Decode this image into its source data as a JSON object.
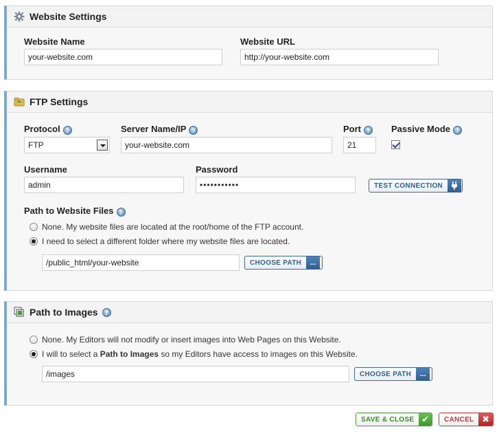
{
  "website_settings": {
    "title": "Website Settings",
    "icon": "gear-icon",
    "name_label": "Website Name",
    "name_value": "your-website.com",
    "url_label": "Website URL",
    "url_value": "http://your-website.com"
  },
  "ftp_settings": {
    "title": "FTP Settings",
    "icon": "ftp-folder-icon",
    "protocol_label": "Protocol",
    "protocol_value": "FTP",
    "server_label": "Server Name/IP",
    "server_value": "your-website.com",
    "port_label": "Port",
    "port_value": "21",
    "passive_label": "Passive Mode",
    "passive_checked": true,
    "username_label": "Username",
    "username_value": "admin",
    "password_label": "Password",
    "password_value": "•••••••••••",
    "test_button": "TEST CONNECTION",
    "path_label": "Path to Website Files",
    "radio_root": "None. My website files are located at the root/home of the FTP account.",
    "radio_folder": "I need to select a different folder where my website files are located.",
    "path_value": "/public_html/your-website",
    "choose_path": "CHOOSE PATH",
    "choose_tail": "..."
  },
  "images": {
    "title": "Path to Images",
    "icon": "images-icon",
    "radio_none": "None. My Editors will not modify or insert images into Web Pages on this Website.",
    "radio_select_prefix": "I will to select a ",
    "radio_select_bold": "Path to Images",
    "radio_select_suffix": " so my Editors have access to images on this Website.",
    "path_value": "/images",
    "choose_path": "CHOOSE PATH",
    "choose_tail": "..."
  },
  "footer": {
    "save": "SAVE & CLOSE",
    "save_glyph": "✔",
    "cancel": "CANCEL",
    "cancel_glyph": "✖"
  },
  "help_glyph": "?"
}
